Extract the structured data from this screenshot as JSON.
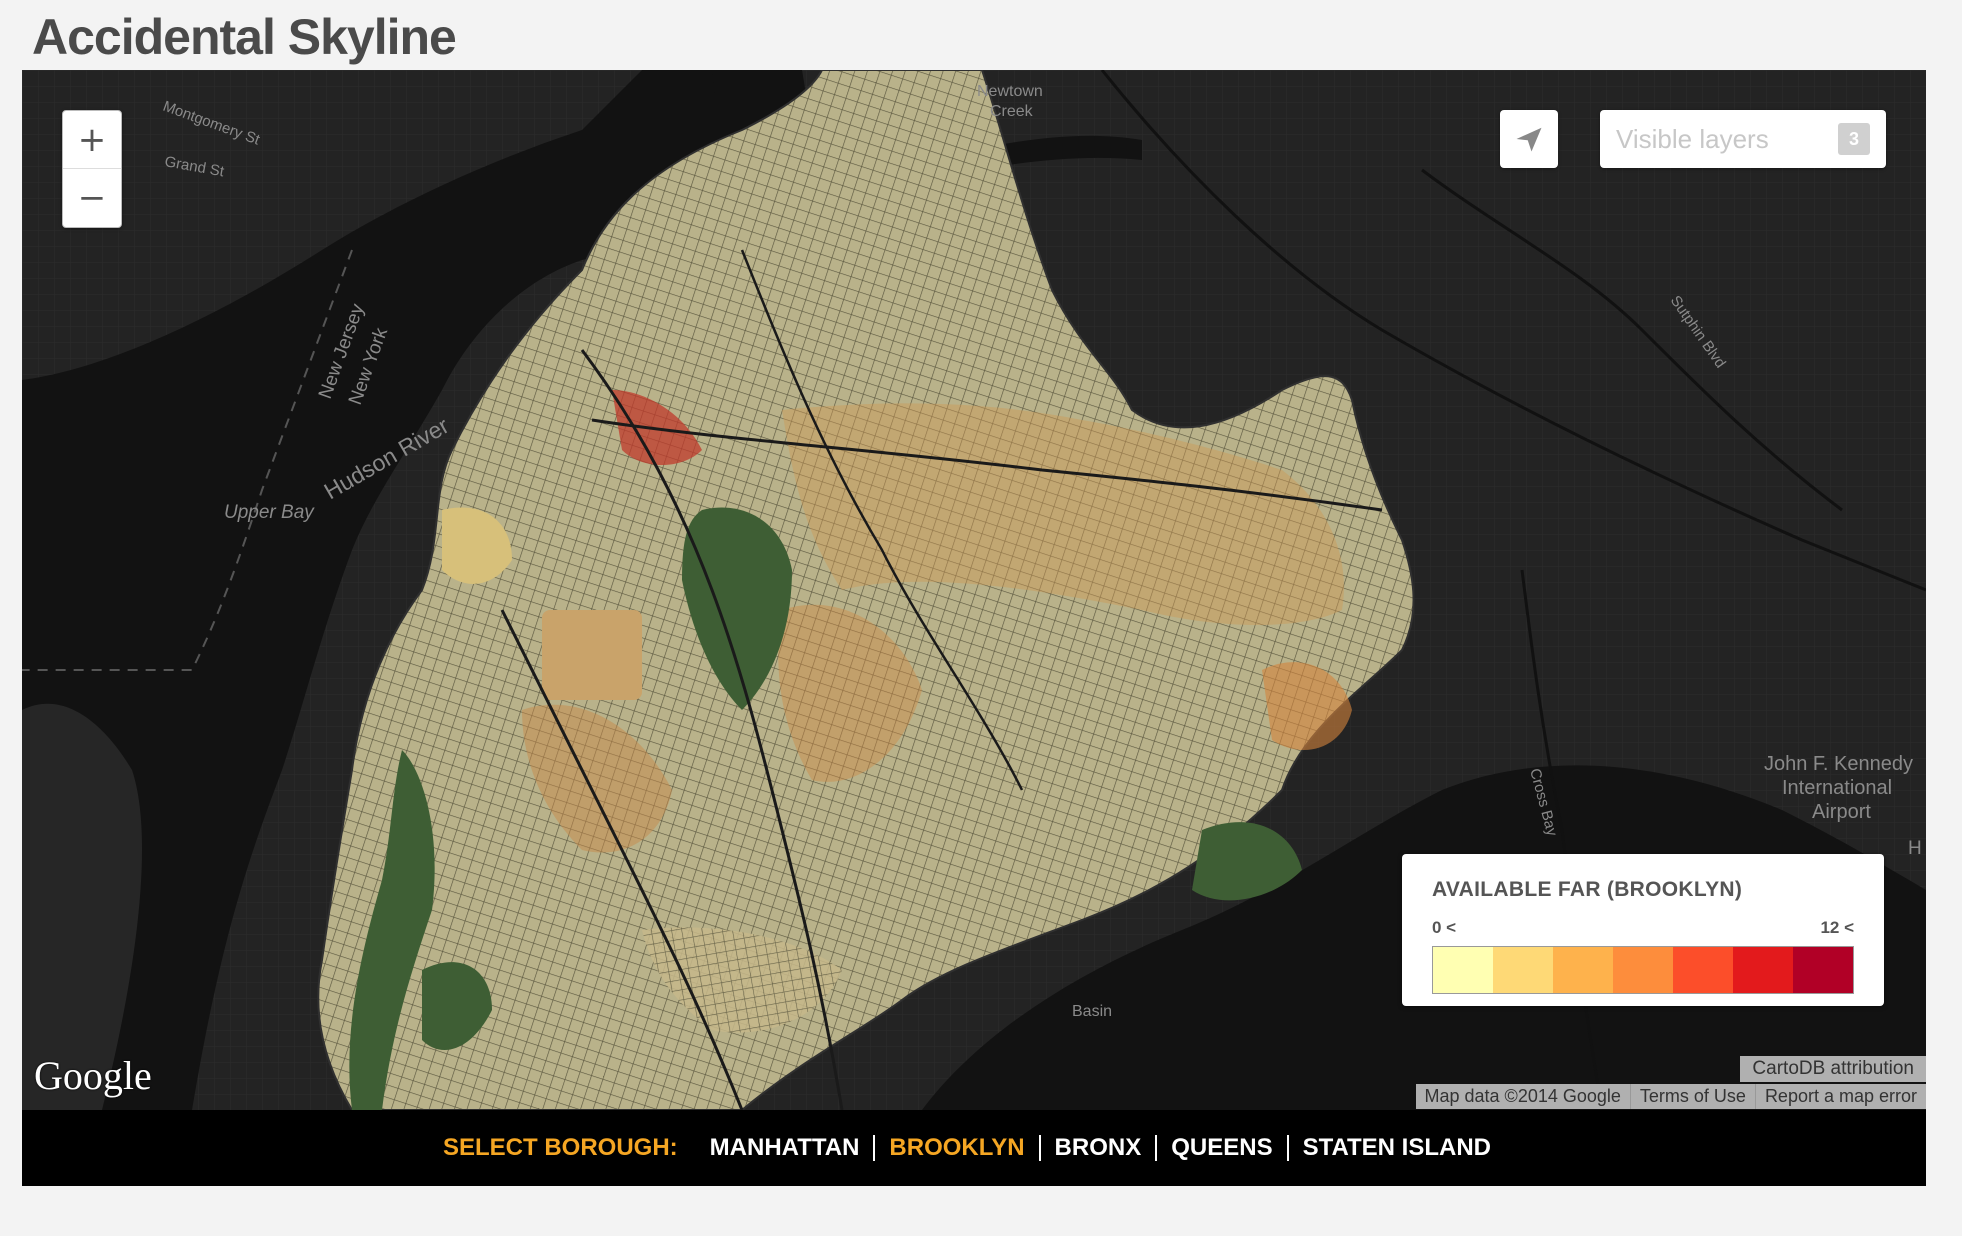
{
  "page": {
    "title": "Accidental Skyline"
  },
  "map": {
    "labels": {
      "montgomery": "Montgomery St",
      "grand": "Grand St",
      "newtown": "Newtown",
      "creek": "Creek",
      "new_jersey": "New Jersey",
      "new_york": "New York",
      "hudson": "Hudson River",
      "upper_bay": "Upper Bay",
      "sutphin": "Sutphin Blvd",
      "jfk_1": "John F. Kennedy",
      "jfk_2": "International",
      "jfk_3": "Airport",
      "cross_bay": "Cross Bay",
      "basin": "Basin",
      "edge_h": "H"
    },
    "zoom": {
      "in": "+",
      "out": "−"
    },
    "share_icon": "paper-plane-icon",
    "layers": {
      "label": "Visible layers",
      "count": "3"
    },
    "google_logo": "Google",
    "attribution": "CartoDB attribution",
    "credits": [
      "Map data ©2014 Google",
      "Terms of Use",
      "Report a map error"
    ]
  },
  "legend": {
    "title": "AVAILABLE FAR (BROOKLYN)",
    "min_label": "0 <",
    "max_label": "12 <",
    "colors": [
      "#ffffb2",
      "#fed976",
      "#feb24c",
      "#fd8d3c",
      "#fc4e2a",
      "#e31a1c",
      "#b10026"
    ]
  },
  "borough_nav": {
    "label": "SELECT BOROUGH:",
    "items": [
      "MANHATTAN",
      "BROOKLYN",
      "BRONX",
      "QUEENS",
      "STATEN ISLAND"
    ],
    "active": "BROOKLYN",
    "active_color": "#f5a623"
  }
}
